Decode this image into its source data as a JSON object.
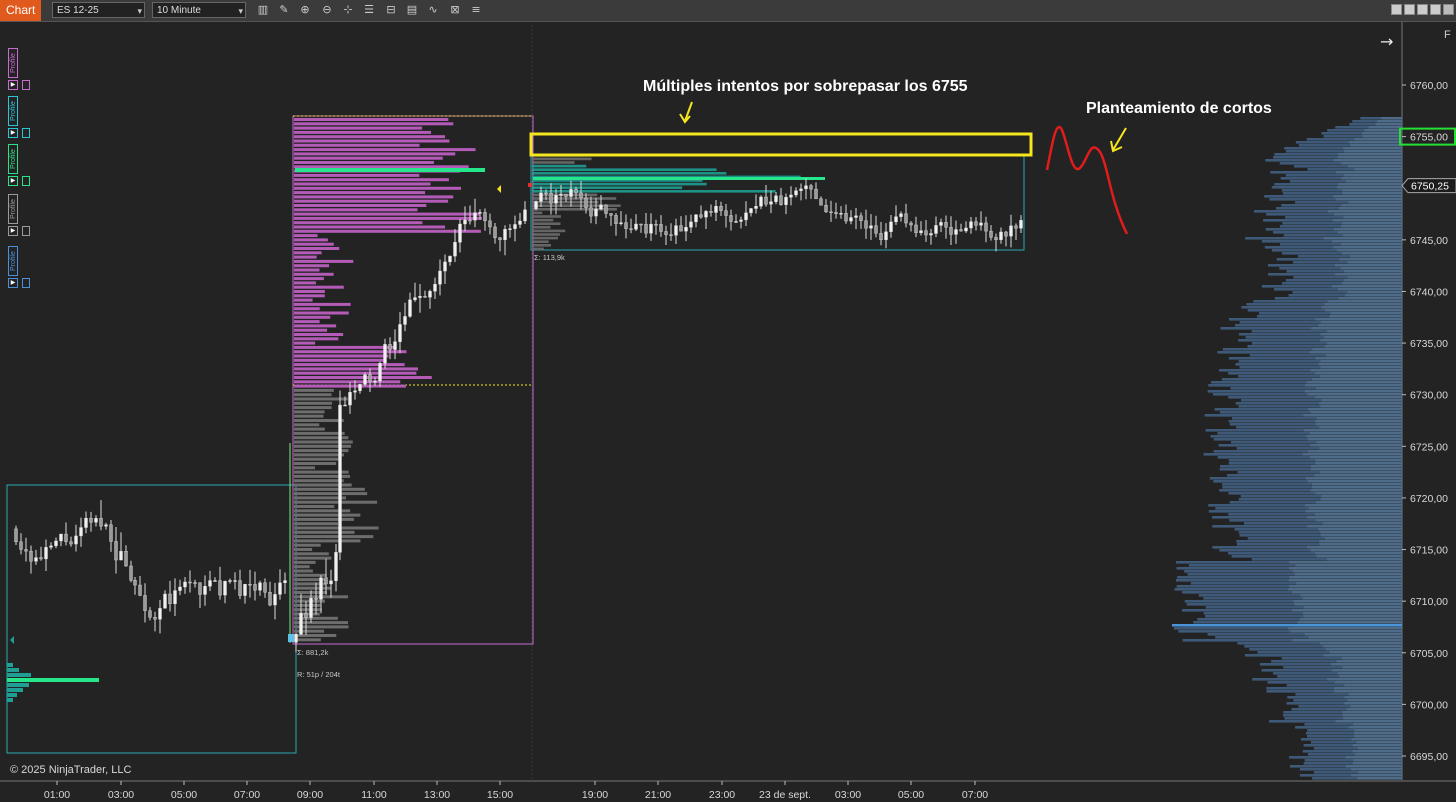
{
  "toolbar": {
    "chart_tab": "Chart",
    "instrument": "ES 12-25",
    "interval": "10 Minute",
    "tools": [
      "bars-icon",
      "pencil-icon",
      "zoom-in-icon",
      "zoom-out-icon",
      "crosshair-icon",
      "properties-icon",
      "templates-icon",
      "data-box-icon",
      "indicators-icon",
      "strategies-icon",
      "list-icon"
    ]
  },
  "right_header": {
    "letter": "F"
  },
  "profile_tabs": [
    {
      "label": "Profile",
      "color": "#c86bd0"
    },
    {
      "label": "Profile",
      "color": "#2ec4d6"
    },
    {
      "label": "Profile",
      "color": "#2fe08a"
    },
    {
      "label": "Profile",
      "color": "#9a9a9a"
    },
    {
      "label": "Profile",
      "color": "#4a8fd8"
    }
  ],
  "price_axis": {
    "ticks": [
      "6760,00",
      "6755,00",
      "6745,00",
      "6740,00",
      "6735,00",
      "6730,00",
      "6725,00",
      "6720,00",
      "6715,00",
      "6710,00",
      "6705,00",
      "6700,00",
      "6695,00"
    ],
    "highlight_price": "6755,00",
    "current_price": "6750,25"
  },
  "time_axis": [
    "01:00",
    "03:00",
    "05:00",
    "07:00",
    "09:00",
    "11:00",
    "13:00",
    "15:00",
    "19:00",
    "21:00",
    "23:00",
    "23 de sept.",
    "03:00",
    "05:00",
    "07:00"
  ],
  "annotations": {
    "main": "Múltiples intentos por sobrepasar los 6755",
    "shorts": "Planteamiento de cortos"
  },
  "profile_stats": {
    "first_sum": "Σ: 881,2k",
    "first_range": "R: 51p / 204t",
    "second_sum": "Σ: 113,9k"
  },
  "copyright": "© 2025 NinjaTrader, LLC",
  "colors": {
    "background": "#232323",
    "orange_tab": "#e05a1e",
    "profile_purple": "#b45bb8",
    "profile_gray": "#6d6d6d",
    "poc_green": "#26e68c",
    "teal": "#1f9e93",
    "yellow": "#f5e61e",
    "red_path": "#e01c1c",
    "right_profile": "#3e5a78",
    "poc_blue": "#4a95d8",
    "green_box": "#25e033"
  }
}
